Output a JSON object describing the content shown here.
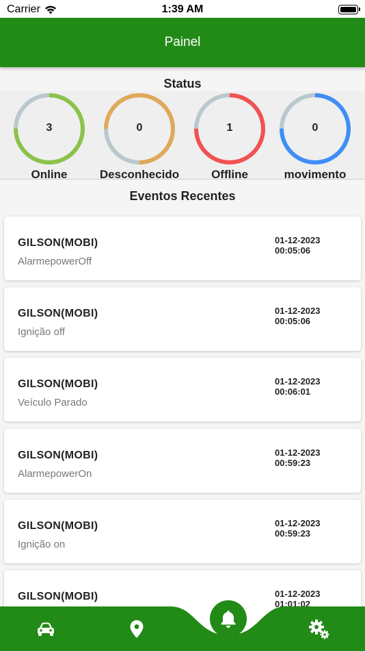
{
  "statusbar": {
    "carrier": "Carrier",
    "time": "1:39 AM"
  },
  "header": {
    "title": "Painel"
  },
  "status": {
    "title": "Status",
    "gauges": [
      {
        "value": "3",
        "label": "Online",
        "color": "#8bc34a",
        "fraction": 0.75
      },
      {
        "value": "0",
        "label": "Desconhecido",
        "color": "#e0a95a",
        "fraction": 0.75
      },
      {
        "value": "1",
        "label": "Offline",
        "color": "#f25252",
        "fraction": 0.75
      },
      {
        "value": "0",
        "label": "movimento",
        "color": "#3f8ef5",
        "fraction": 0.75
      }
    ]
  },
  "events": {
    "title": "Eventos Recentes",
    "items": [
      {
        "name": "GILSON(MOBI)",
        "desc": "AlarmepowerOff",
        "date": "01-12-2023",
        "time": "00:05:06"
      },
      {
        "name": "GILSON(MOBI)",
        "desc": "Ignição off",
        "date": "01-12-2023",
        "time": "00:05:06"
      },
      {
        "name": "GILSON(MOBI)",
        "desc": "Veículo Parado",
        "date": "01-12-2023",
        "time": "00:06:01"
      },
      {
        "name": "GILSON(MOBI)",
        "desc": "AlarmepowerOn",
        "date": "01-12-2023",
        "time": "00:59:23"
      },
      {
        "name": "GILSON(MOBI)",
        "desc": "Ignição on",
        "date": "01-12-2023",
        "time": "00:59:23"
      },
      {
        "name": "GILSON(MOBI)",
        "desc": "",
        "date": "01-12-2023",
        "time": "01:01:02"
      }
    ]
  },
  "nav": {
    "items": [
      "car-icon",
      "location-pin-icon",
      "bell-icon",
      "settings-gears-icon"
    ],
    "active": "bell-icon",
    "color": "#228a17"
  }
}
